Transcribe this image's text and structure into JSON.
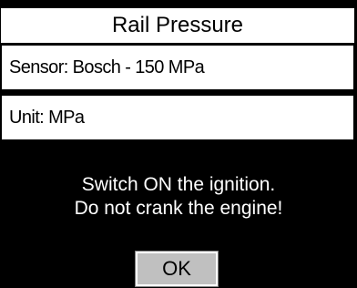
{
  "header": {
    "title": "Rail Pressure"
  },
  "info": {
    "sensor": "Sensor: Bosch - 150 MPa",
    "unit": "Unit: MPa"
  },
  "dialog": {
    "line1": "Switch ON the ignition.",
    "line2": "Do not crank the engine!",
    "ok_label": "OK"
  },
  "colors": {
    "background": "#000000",
    "panel": "#ffffff",
    "button": "#c0c0c0"
  }
}
